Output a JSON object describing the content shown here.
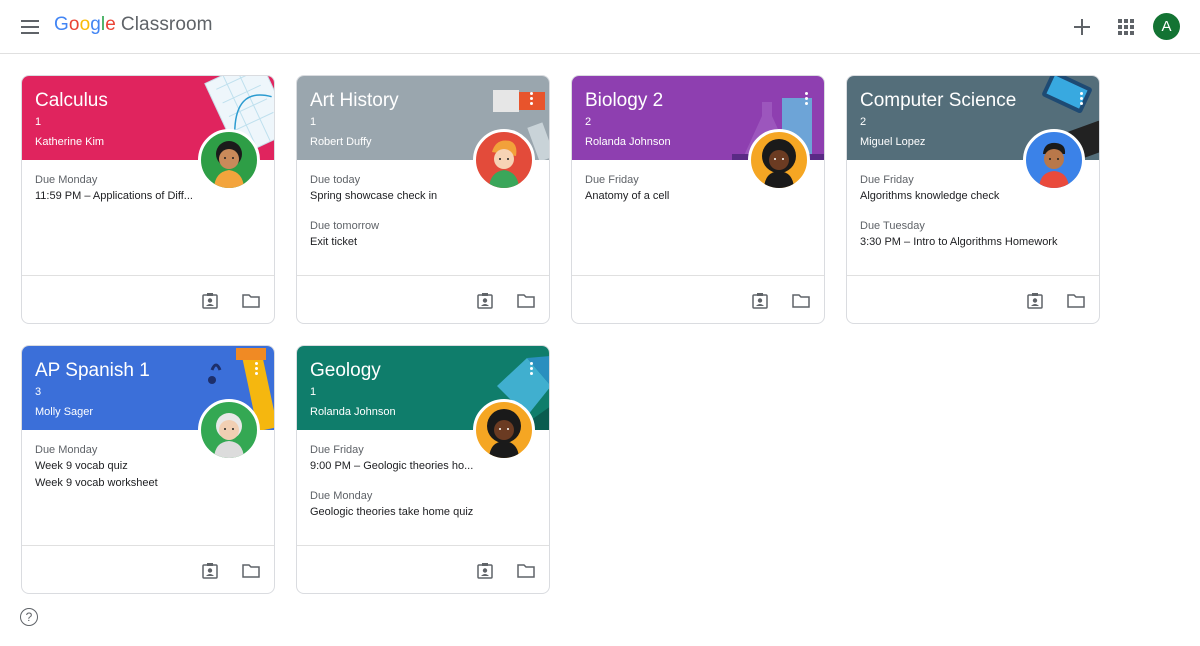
{
  "app": {
    "logo_parts": [
      "G",
      "o",
      "o",
      "g",
      "l",
      "e"
    ],
    "product": "Classroom",
    "account_initial": "A"
  },
  "icons": {
    "menu": "hamburger-menu-icon",
    "add": "plus-icon",
    "apps": "apps-grid-icon",
    "help": "help-icon",
    "help_glyph": "?"
  },
  "courses": [
    {
      "name": "Calculus",
      "section": "1",
      "teacher": "Katherine Kim",
      "color": "#e0245e",
      "due": [
        {
          "label": "Due Monday",
          "items": [
            "11:59 PM – Applications of Diff..."
          ]
        }
      ]
    },
    {
      "name": "Art History",
      "section": "1",
      "teacher": "Robert Duffy",
      "color": "#9aa6ae",
      "due": [
        {
          "label": "Due today",
          "items": [
            "Spring showcase check in"
          ]
        },
        {
          "label": "Due tomorrow",
          "items": [
            "Exit ticket"
          ]
        }
      ]
    },
    {
      "name": "Biology 2",
      "section": "2",
      "teacher": "Rolanda Johnson",
      "color": "#8e3fb0",
      "due": [
        {
          "label": "Due Friday",
          "items": [
            "Anatomy of a cell"
          ]
        }
      ]
    },
    {
      "name": "Computer Science",
      "section": "2",
      "teacher": "Miguel Lopez",
      "color": "#546e7a",
      "due": [
        {
          "label": "Due Friday",
          "items": [
            "Algorithms knowledge check"
          ]
        },
        {
          "label": "Due Tuesday",
          "items": [
            "3:30 PM – Intro to Algorithms Homework"
          ]
        }
      ]
    },
    {
      "name": "AP Spanish 1",
      "section": "3",
      "teacher": "Molly Sager",
      "color": "#3b6fd9",
      "due": [
        {
          "label": "Due Monday",
          "items": [
            "Week 9 vocab quiz",
            "Week 9 vocab worksheet"
          ]
        }
      ]
    },
    {
      "name": "Geology",
      "section": "1",
      "teacher": "Rolanda Johnson",
      "color": "#0f7d6b",
      "due": [
        {
          "label": "Due Friday",
          "items": [
            "9:00 PM – Geologic theories ho..."
          ]
        },
        {
          "label": "Due Monday",
          "items": [
            "Geologic theories take home quiz"
          ]
        }
      ]
    }
  ]
}
